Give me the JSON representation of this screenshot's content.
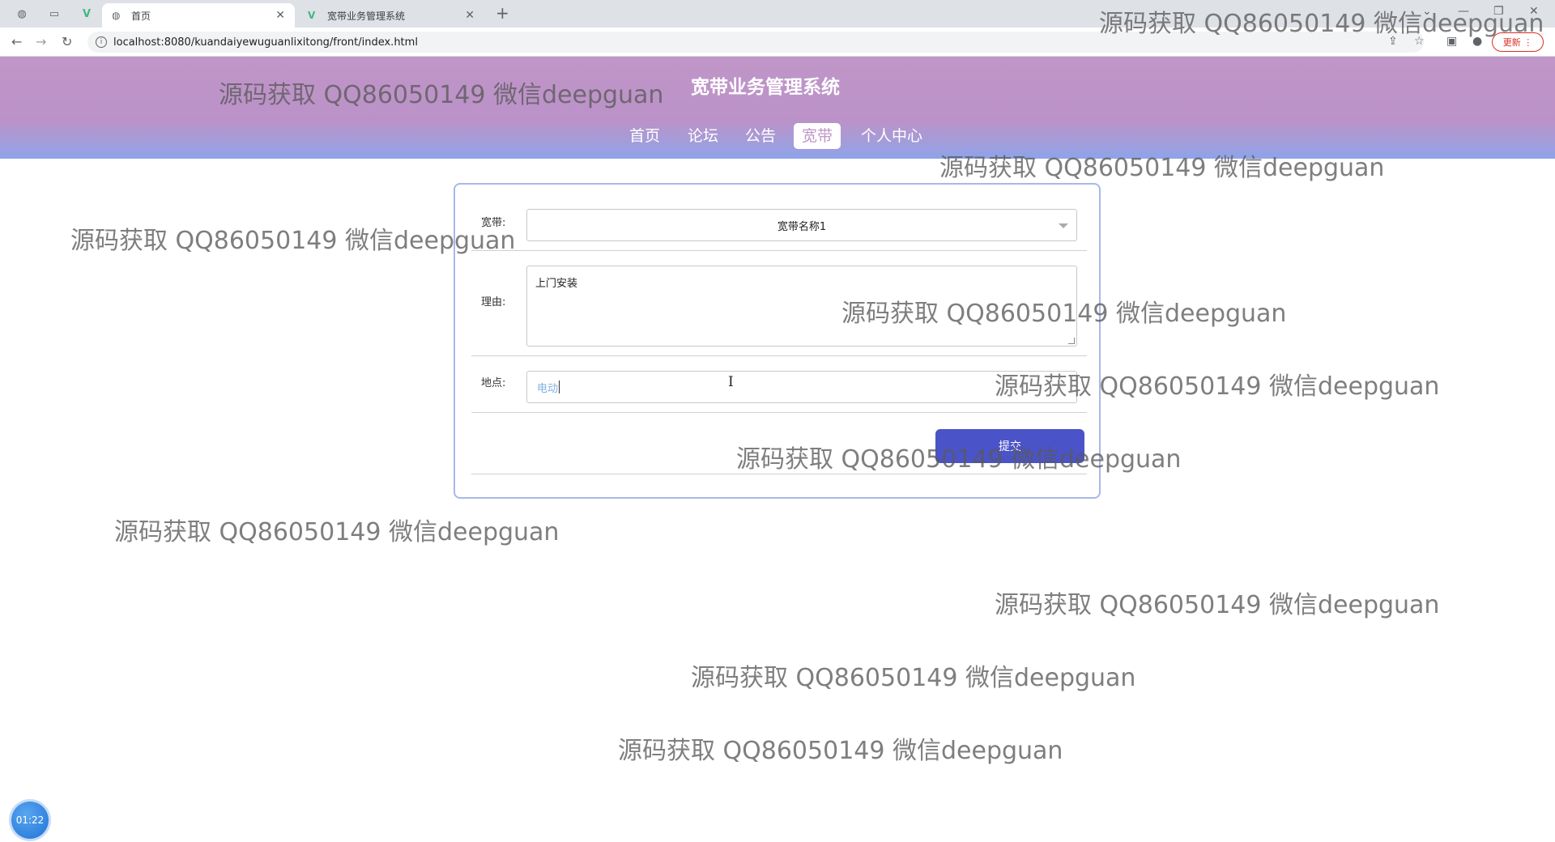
{
  "browser": {
    "tabs": [
      {
        "title": "首页",
        "active": true
      },
      {
        "title": "宽带业务管理系统",
        "active": false
      }
    ],
    "url": "localhost:8080/kuandaiyewuguanlixitong/front/index.html",
    "update_label": "更新"
  },
  "site": {
    "title": "宽带业务管理系统",
    "nav": [
      {
        "label": "首页",
        "active": false
      },
      {
        "label": "论坛",
        "active": false
      },
      {
        "label": "公告",
        "active": false
      },
      {
        "label": "宽带",
        "active": true
      },
      {
        "label": "个人中心",
        "active": false
      }
    ]
  },
  "form": {
    "broadband_label": "宽带:",
    "broadband_value": "宽带名称1",
    "reason_label": "理由:",
    "reason_value": "上门安装",
    "location_label": "地点:",
    "location_value": "电动",
    "submit_label": "提交"
  },
  "watermark_text": "源码获取 QQ86050149 微信deepguan",
  "timer": "01:22",
  "colors": {
    "header": "#c096c8",
    "header_bottom": "#8fa3ea",
    "submit": "#4a53c8",
    "card_border": "#a9b8ea"
  }
}
